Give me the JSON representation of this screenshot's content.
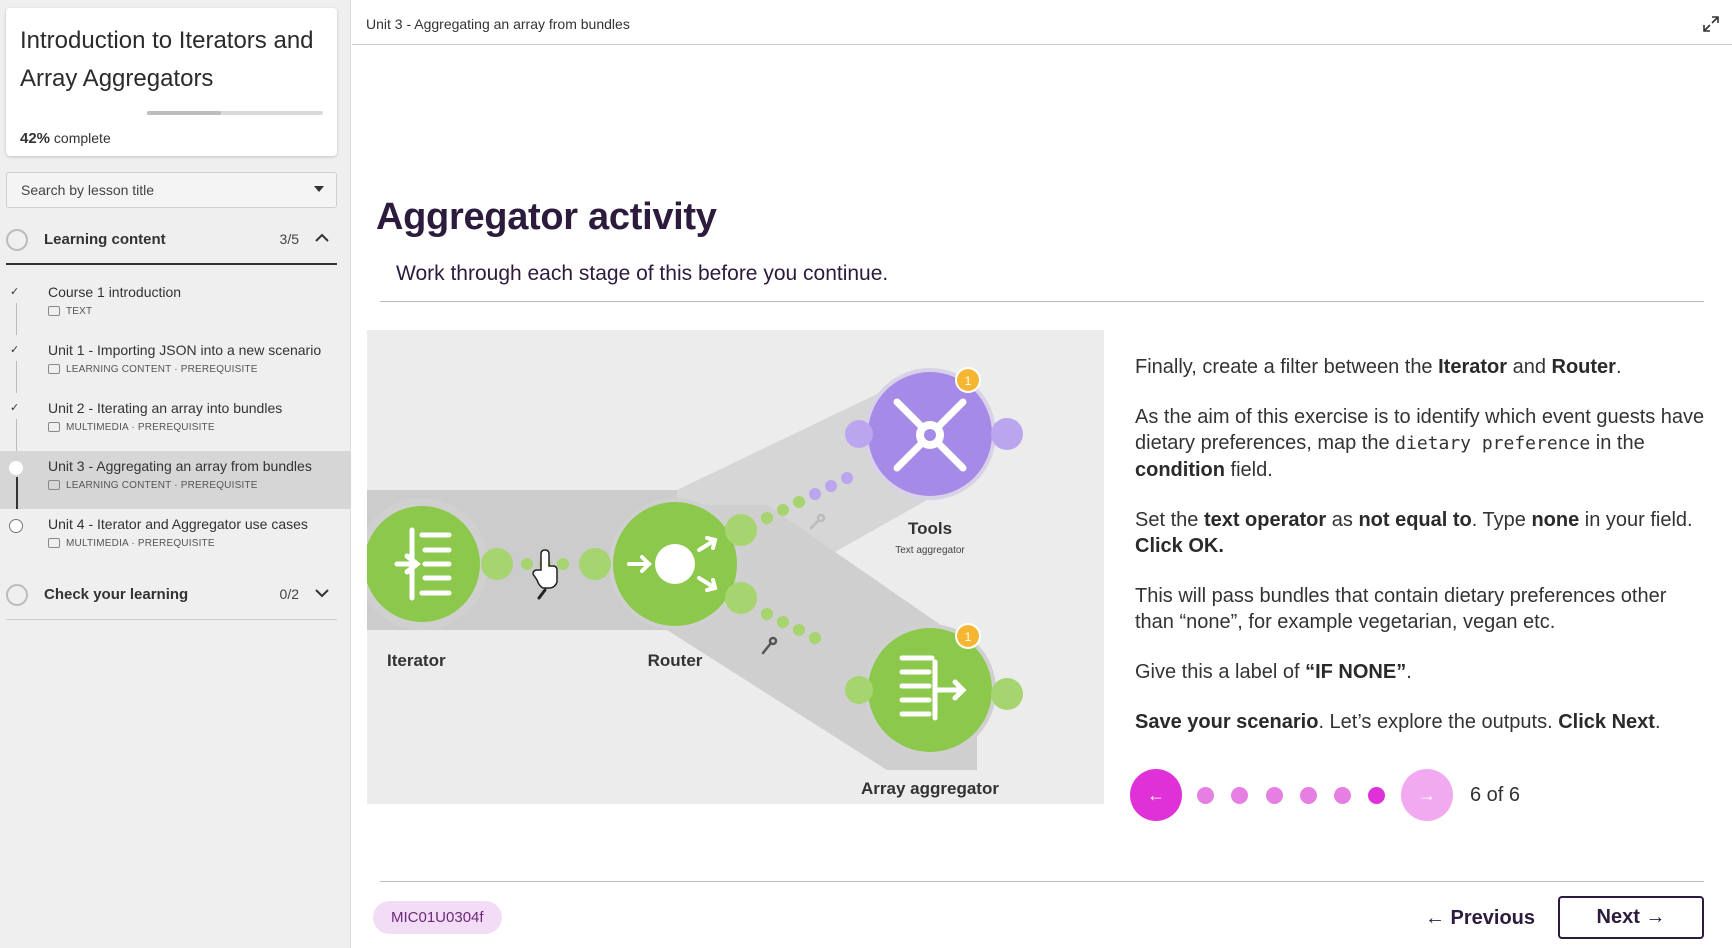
{
  "sidebar": {
    "course_title": "Introduction to Iterators and Array Aggregators",
    "progress_percent": "42%",
    "progress_label": "complete",
    "progress_value": 0.42,
    "search_placeholder": "Search by lesson title",
    "sections": [
      {
        "label": "Learning content",
        "count": "3/5",
        "expanded": true
      },
      {
        "label": "Check your learning",
        "count": "0/2",
        "expanded": false
      }
    ],
    "lessons": [
      {
        "title": "Course 1 introduction",
        "meta": "TEXT",
        "status": "complete"
      },
      {
        "title": "Unit 1 - Importing JSON into a new scenario",
        "meta": "LEARNING CONTENT · PREREQUISITE",
        "status": "complete"
      },
      {
        "title": "Unit 2 - Iterating an array into bundles",
        "meta": "MULTIMEDIA · PREREQUISITE",
        "status": "complete"
      },
      {
        "title": "Unit 3 - Aggregating an array from bundles",
        "meta": "LEARNING CONTENT · PREREQUISITE",
        "status": "current"
      },
      {
        "title": "Unit 4 - Iterator and Aggregator use cases",
        "meta": "MULTIMEDIA · PREREQUISITE",
        "status": "incomplete"
      }
    ]
  },
  "topbar": {
    "breadcrumb": "Unit 3 - Aggregating an array from bundles"
  },
  "main": {
    "title": "Aggregator activity",
    "subtitle": "Work through each stage of this before you continue.",
    "diagram": {
      "nodes": {
        "iterator": "Iterator",
        "router": "Router",
        "tools": "Tools",
        "tools_sub": "Text aggregator",
        "array_aggregator": "Array aggregator"
      },
      "badge_tools": "1",
      "badge_array": "1"
    },
    "paragraphs": {
      "p1": {
        "a": "Finally, create a filter between the ",
        "b": "Iterator",
        "c": " and ",
        "d": "Router",
        "e": "."
      },
      "p2": {
        "a": "As the aim of this exercise is to identify which event guests have dietary preferences, map the ",
        "code": "dietary preference",
        "b": " in the ",
        "c": "condition",
        "d": " field."
      },
      "p3": {
        "a": "Set the ",
        "b": "text operator",
        "c": " as ",
        "d": "not equal to",
        "e": ". Type ",
        "f": "none",
        "g": " in your field. ",
        "h": "Click OK."
      },
      "p4": {
        "a": "This will pass bundles that contain dietary preferences other than “none”, for example vegetarian, vegan etc."
      },
      "p5": {
        "a": "Give this a label of ",
        "b": "“IF NONE”",
        "c": "."
      },
      "p6": {
        "a": "Save your scenario",
        "b": ". Let’s explore the outputs. ",
        "c": "Click Next",
        "d": "."
      }
    },
    "carousel": {
      "counter": "6 of 6",
      "prev_icon": "←",
      "next_icon": "→",
      "total": 6,
      "current": 6
    }
  },
  "footer": {
    "lesson_code": "MIC01U0304f",
    "previous_label": "← Previous",
    "next_label": "Next →"
  },
  "colors": {
    "accent": "#e030d8",
    "accent_light": "#f1aaf0",
    "dot": "#e77fe2",
    "title": "#2c1b3d",
    "node_green": "#8cc84b",
    "node_purple": "#a58ae8"
  }
}
